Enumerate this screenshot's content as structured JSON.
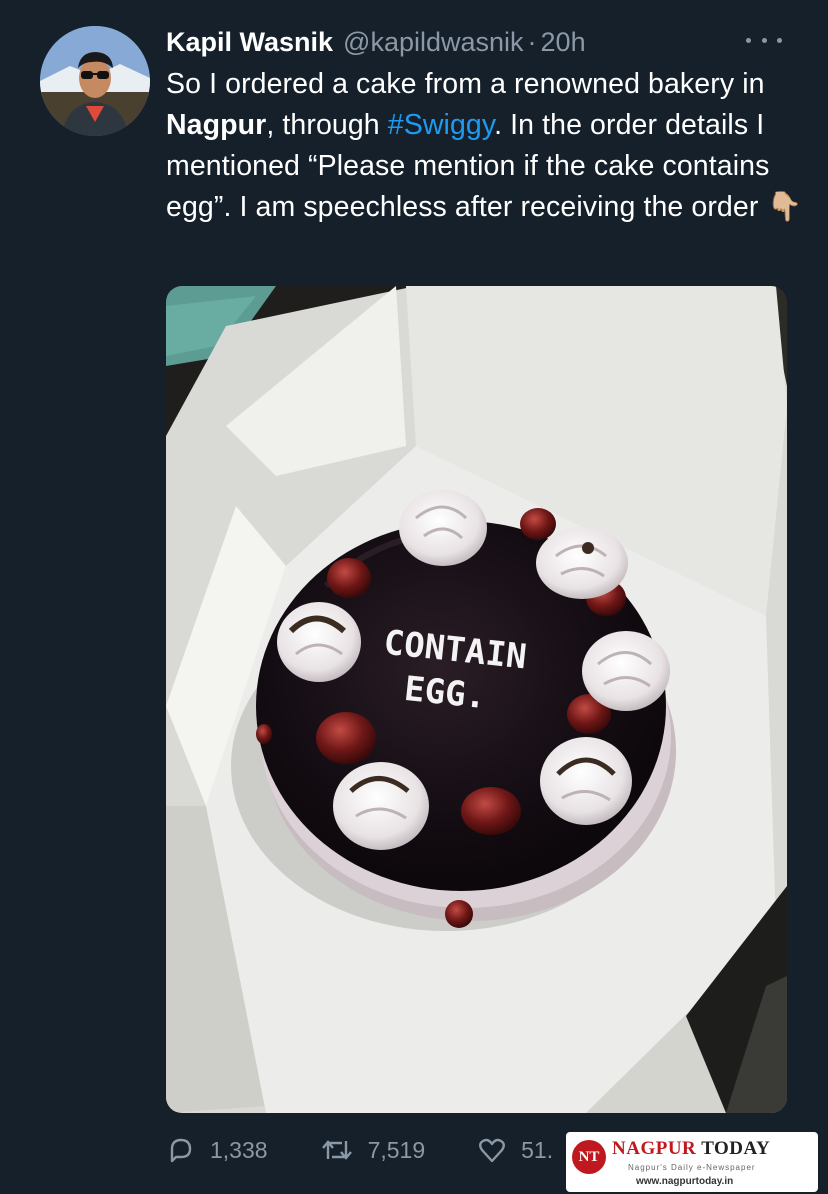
{
  "tweet": {
    "display_name": "Kapil Wasnik",
    "handle": "@kapildwasnik",
    "separator": "·",
    "time": "20h",
    "text_parts": {
      "p1": "So I ordered a cake from a renowned bakery in ",
      "p2": "Nagpur",
      "p3": ", through ",
      "p4": "#Swiggy",
      "p5": ". In the order details I mentioned “Please mention if the cake contains egg”. I am speechless after receiving the order ",
      "p6": "👇🏼"
    },
    "image_text": {
      "line1": "CONTAIN",
      "line2": "EGG."
    }
  },
  "actions": {
    "reply_count": "1,338",
    "retweet_count": "7,519",
    "like_count": "51."
  },
  "watermark": {
    "badge": "NT",
    "nagpur": "NAGPUR",
    "today": "TODAY",
    "tag": "Nagpur's Daily e-Newspaper",
    "url": "www.nagpurtoday.in"
  },
  "icons": {
    "more": "more-icon",
    "reply": "reply-icon",
    "retweet": "retweet-icon",
    "like": "like-icon",
    "share": "share-icon"
  },
  "colors": {
    "background": "#15202b",
    "hashtag": "#1d9bf0",
    "muted": "#8b98a5",
    "brand_red": "#c0181f"
  }
}
